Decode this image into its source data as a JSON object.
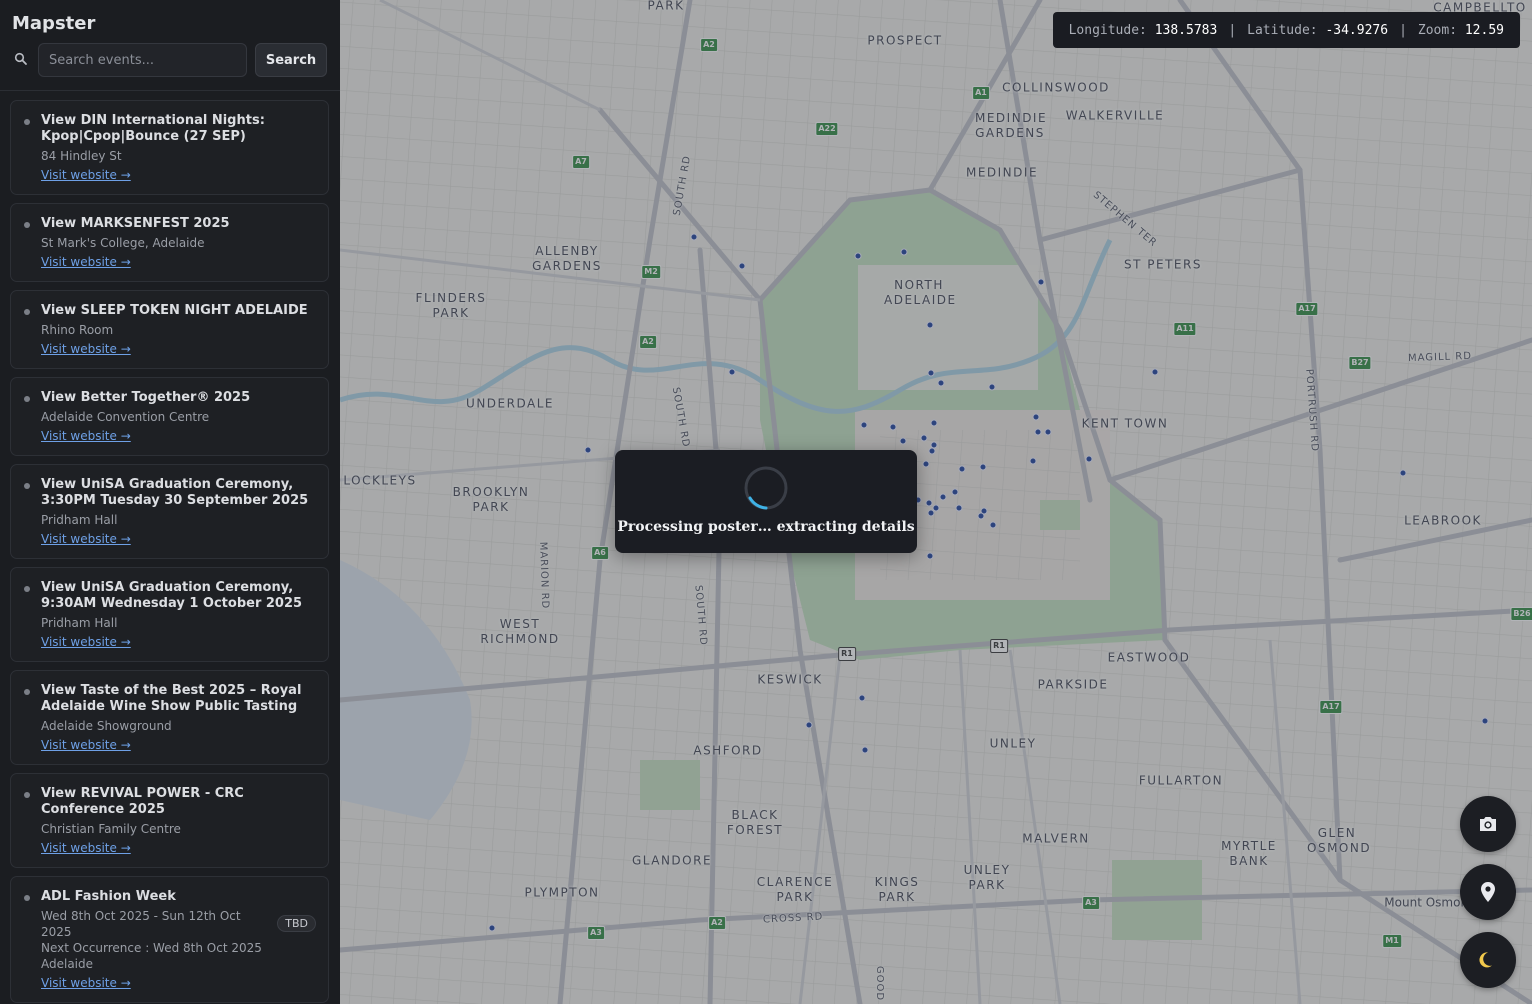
{
  "app": {
    "title": "Mapster"
  },
  "search": {
    "placeholder": "Search events...",
    "value": "",
    "button_label": "Search"
  },
  "coords": {
    "longitude_label": "Longitude:",
    "longitude": "138.5783",
    "latitude_label": "Latitude:",
    "latitude": "-34.9276",
    "zoom_label": "Zoom:",
    "zoom": "12.59",
    "separator": "|"
  },
  "events": [
    {
      "title": "View DIN International Nights: Kpop|Cpop|Bounce (27 SEP)",
      "venue": "84 Hindley St",
      "link": "Visit website →"
    },
    {
      "title": "View MARKSENFEST 2025",
      "venue": "St Mark's College, Adelaide",
      "link": "Visit website →"
    },
    {
      "title": "View SLEEP TOKEN NIGHT ADELAIDE",
      "venue": "Rhino Room",
      "link": "Visit website →"
    },
    {
      "title": "View Better Together® 2025",
      "venue": "Adelaide Convention Centre",
      "link": "Visit website →"
    },
    {
      "title": "View UniSA Graduation Ceremony, 3:30PM Tuesday 30 September 2025",
      "venue": "Pridham Hall",
      "link": "Visit website →"
    },
    {
      "title": "View UniSA Graduation Ceremony, 9:30AM Wednesday 1 October 2025",
      "venue": "Pridham Hall",
      "link": "Visit website →"
    },
    {
      "title": "View Taste of the Best 2025 – Royal Adelaide Wine Show Public Tasting",
      "venue": "Adelaide Showground",
      "link": "Visit website →"
    },
    {
      "title": "View REVIVAL POWER - CRC Conference 2025",
      "venue": "Christian Family Centre",
      "link": "Visit website →"
    },
    {
      "title": "ADL Fashion Week",
      "dates": "Wed 8th Oct 2025 - Sun 12th Oct 2025",
      "next": "Next Occurrence : Wed 8th Oct 2025",
      "venue": "Adelaide",
      "badge": "TBD",
      "link": "Visit website →"
    }
  ],
  "processing": {
    "message": "Processing poster… extracting details"
  },
  "map": {
    "suburbs": [
      "PARK",
      "PROSPECT",
      "COLLINSWOOD",
      "MEDINDIE GARDENS",
      "WALKERVILLE",
      "MEDINDIE",
      "ALLENBY GARDENS",
      "FLINDERS PARK",
      "NORTH ADELAIDE",
      "ST PETERS",
      "UNDERDALE",
      "KENT TOWN",
      "LOCKLEYS",
      "BROOKLYN PARK",
      "LEABROOK",
      "WEST RICHMOND",
      "EASTWOOD",
      "PARKSIDE",
      "KESWICK",
      "ASHFORD",
      "UNLEY",
      "FULLARTON",
      "BLACK FOREST",
      "MALVERN",
      "GLEN OSMOND",
      "MYRTLE BANK",
      "GLANDORE",
      "CLARENCE PARK",
      "KINGS PARK",
      "UNLEY PARK",
      "PLYMPTON",
      "Mount Osmond",
      "CAMPBELLTO"
    ],
    "roads": [
      "SOUTH RD",
      "STEPHEN TER",
      "MAGILL RD",
      "PORTRUSH RD",
      "MARION RD",
      "CROSS RD",
      "GOOD"
    ],
    "shields": [
      "A2",
      "A1",
      "A22",
      "A7",
      "M2",
      "A2",
      "A11",
      "A17",
      "B27",
      "A6",
      "R1",
      "R1",
      "A17",
      "B26",
      "A2",
      "A3",
      "A3",
      "M1"
    ]
  },
  "colors": {
    "sidebar_bg": "#1b1d21",
    "link": "#6ea0e6",
    "marker": "#1b3e9a",
    "park": "#b9dcb6",
    "water": "#a8cfe0"
  },
  "icons": {
    "search": "search-icon",
    "camera": "camera-icon",
    "location": "map-pin-icon",
    "theme": "moon-icon"
  }
}
